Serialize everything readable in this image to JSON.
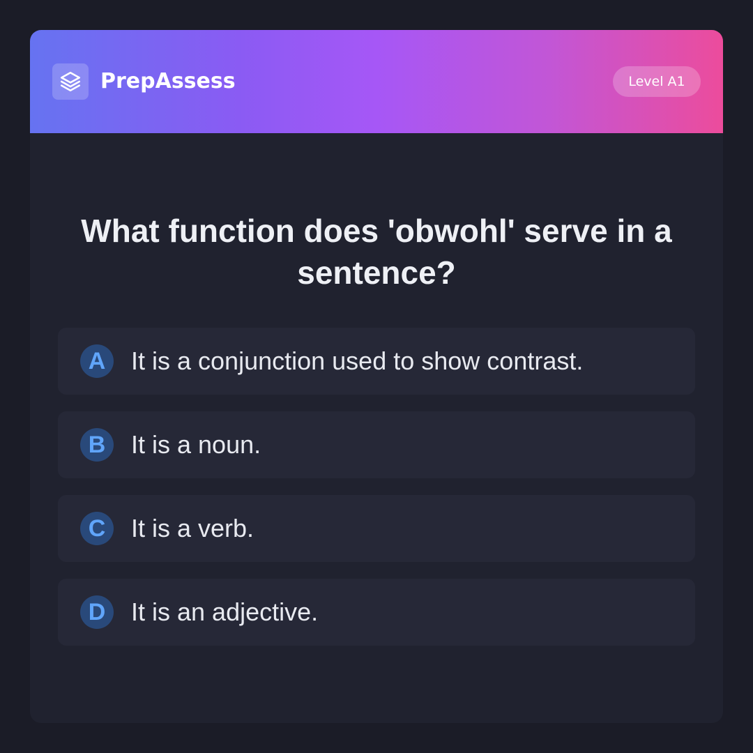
{
  "header": {
    "brand": "PrepAssess",
    "logo_icon": "layers-icon",
    "level": "Level A1",
    "gradient": [
      "#6673f1",
      "#a657f6",
      "#ec4c9c"
    ]
  },
  "question": {
    "text": "What function does 'obwohl' serve in a sentence?"
  },
  "options": [
    {
      "letter": "A",
      "text": "It is a conjunction used to show contrast."
    },
    {
      "letter": "B",
      "text": "It is a noun."
    },
    {
      "letter": "C",
      "text": "It is a verb."
    },
    {
      "letter": "D",
      "text": "It is an adjective."
    }
  ],
  "colors": {
    "background": "#1b1c27",
    "card": "#20222f",
    "option_bg": "#262837",
    "accent": "#60a5fa"
  }
}
